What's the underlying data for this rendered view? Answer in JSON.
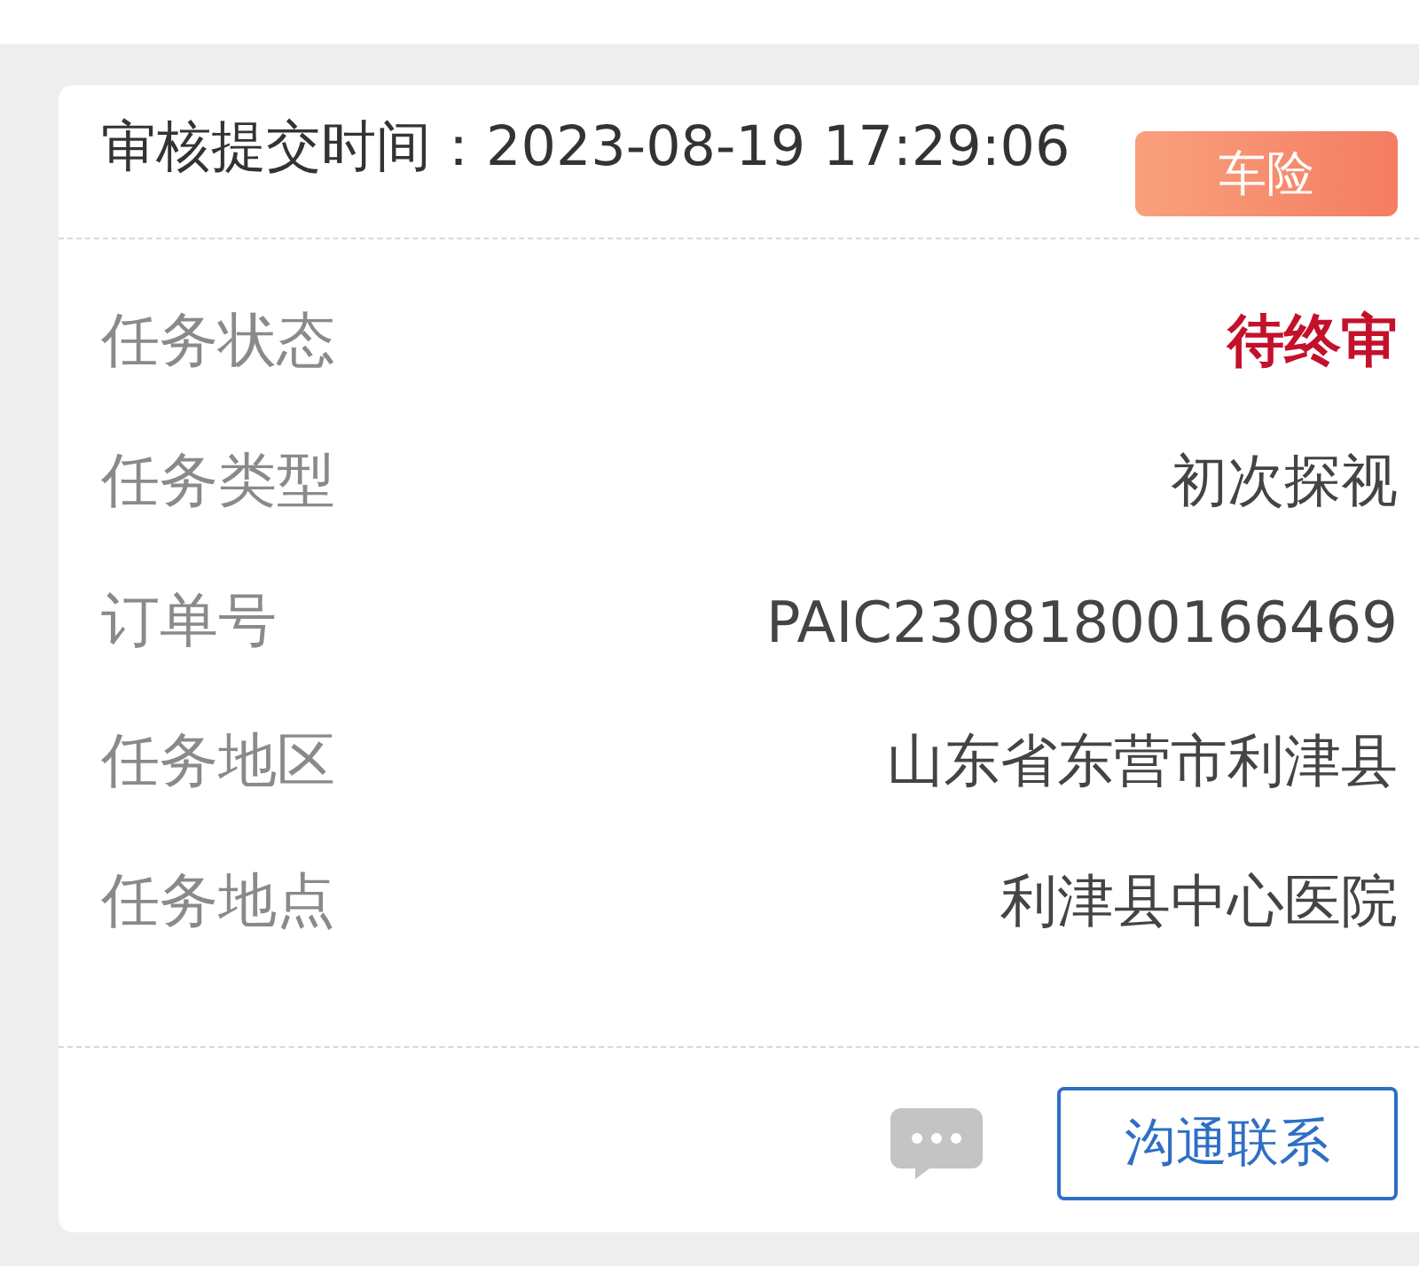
{
  "card": {
    "submit_time": "审核提交时间：2023-08-19 17:29:06",
    "badge": "车险",
    "rows": [
      {
        "label": "任务状态",
        "value": "待终审",
        "kind": "status"
      },
      {
        "label": "任务类型",
        "value": "初次探视",
        "kind": "text"
      },
      {
        "label": "订单号",
        "value": "PAIC23081800166469",
        "kind": "text"
      },
      {
        "label": "任务地区",
        "value": "山东省东营市利津县",
        "kind": "text"
      },
      {
        "label": "任务地点",
        "value": "利津县中心医院",
        "kind": "text"
      }
    ],
    "contact_button": "沟通联系"
  }
}
